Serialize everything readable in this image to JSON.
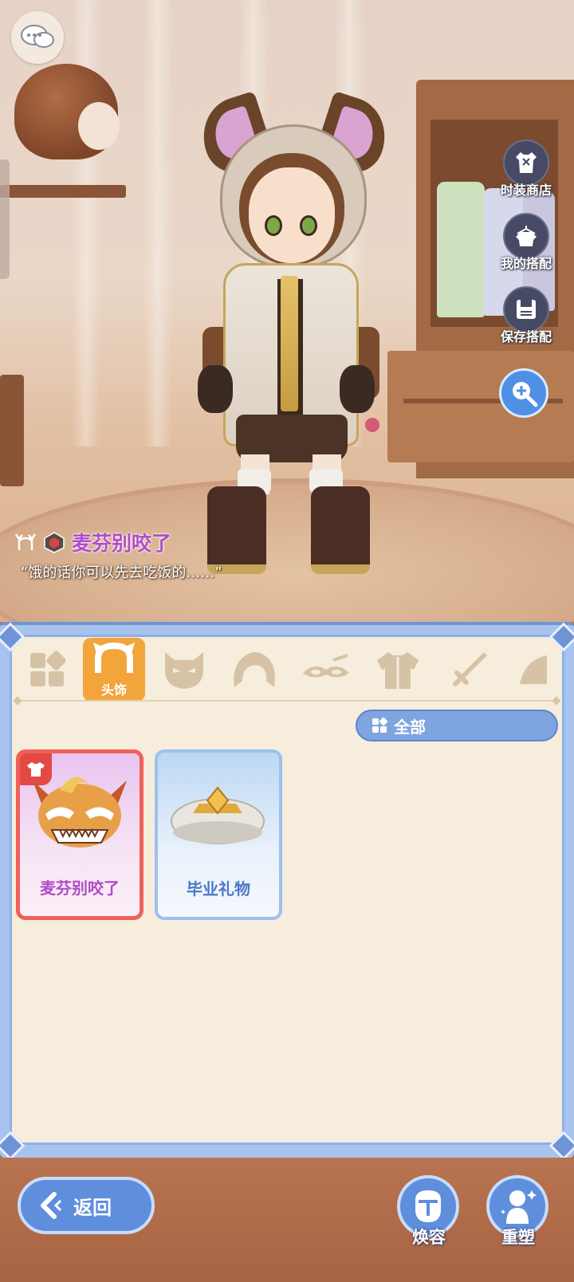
{
  "scene": {
    "player": {
      "name": "麦芬别咬了",
      "quote": "“饿的话你可以先去吃饭的……”"
    }
  },
  "right_menu": [
    {
      "label": "时装商店",
      "icon": "outfit-shop-icon"
    },
    {
      "label": "我的搭配",
      "icon": "my-outfit-icon"
    },
    {
      "label": "保存搭配",
      "icon": "save-outfit-icon"
    }
  ],
  "zoom": {
    "icon": "zoom-in-icon"
  },
  "panel": {
    "tabs": [
      {
        "icon": "grid-icon",
        "label": ""
      },
      {
        "icon": "headwear-icon",
        "label": "头饰",
        "active": true
      },
      {
        "icon": "mask-icon",
        "label": ""
      },
      {
        "icon": "hair-icon",
        "label": ""
      },
      {
        "icon": "face-accessory-icon",
        "label": ""
      },
      {
        "icon": "top-clothing-icon",
        "label": ""
      },
      {
        "icon": "sword-icon",
        "label": ""
      },
      {
        "icon": "more-icon",
        "label": ""
      }
    ],
    "filter": {
      "label": "全部"
    },
    "items": [
      {
        "name": "麦芬别咬了",
        "equipped": true
      },
      {
        "name": "毕业礼物",
        "equipped": false
      }
    ]
  },
  "bottom": {
    "back_label": "返回",
    "makeover_label": "焕容",
    "reshape_label": "重塑"
  },
  "colors": {
    "accent_blue": "#5f8fdc",
    "tab_active": "#f2a53a",
    "player_name": "#b04cc7",
    "panel_bg": "#f6eddd"
  }
}
